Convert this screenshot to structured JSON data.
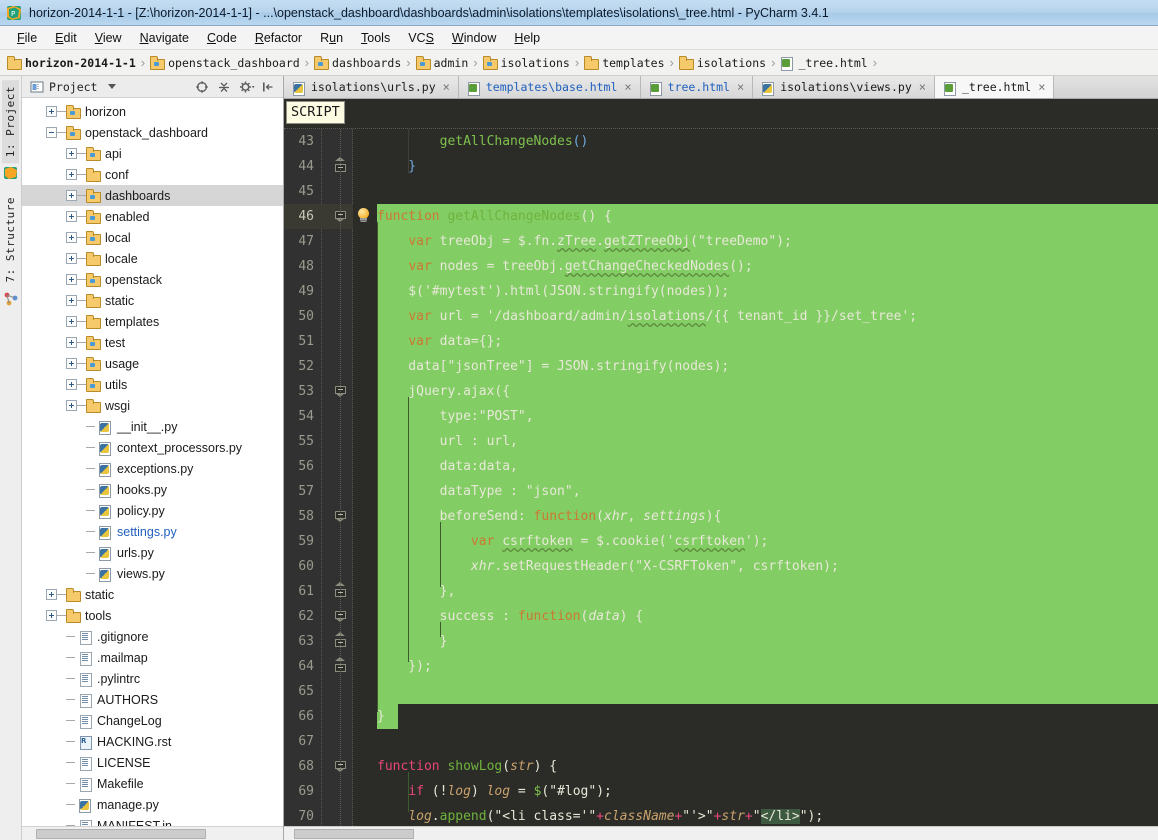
{
  "window": {
    "title": "horizon-2014-1-1 - [Z:\\horizon-2014-1-1] - ...\\openstack_dashboard\\dashboards\\admin\\isolations\\templates\\isolations\\_tree.html - PyCharm 3.4.1",
    "app_name": "PyCharm 3.4.1"
  },
  "menu": {
    "items": [
      {
        "label": "File",
        "mnemonic": "F"
      },
      {
        "label": "Edit",
        "mnemonic": "E"
      },
      {
        "label": "View",
        "mnemonic": "V"
      },
      {
        "label": "Navigate",
        "mnemonic": "N"
      },
      {
        "label": "Code",
        "mnemonic": "C"
      },
      {
        "label": "Refactor",
        "mnemonic": "R"
      },
      {
        "label": "Run",
        "mnemonic": "u"
      },
      {
        "label": "Tools",
        "mnemonic": "T"
      },
      {
        "label": "VCS",
        "mnemonic": "S"
      },
      {
        "label": "Window",
        "mnemonic": "W"
      },
      {
        "label": "Help",
        "mnemonic": "H"
      }
    ]
  },
  "breadcrumb": {
    "separator": "›",
    "items": [
      {
        "label": "horizon-2014-1-1",
        "icon": "folder-icon",
        "root": true
      },
      {
        "label": "openstack_dashboard",
        "icon": "package-folder-icon"
      },
      {
        "label": "dashboards",
        "icon": "package-folder-icon"
      },
      {
        "label": "admin",
        "icon": "package-folder-icon"
      },
      {
        "label": "isolations",
        "icon": "package-folder-icon"
      },
      {
        "label": "templates",
        "icon": "folder-icon"
      },
      {
        "label": "isolations",
        "icon": "folder-icon"
      },
      {
        "label": "_tree.html",
        "icon": "html-file-icon"
      }
    ]
  },
  "toolstrip": {
    "tabs": [
      {
        "label": "1: Project",
        "icon": "project-icon",
        "selected": true
      },
      {
        "label": "7: Structure",
        "icon": "structure-icon",
        "selected": false
      }
    ]
  },
  "project_panel": {
    "title": "Project",
    "title_icon": "project-view-icon",
    "dropdown_icon": "chevron-down-icon",
    "tools": [
      {
        "name": "scroll-from-source-icon",
        "glyph": "target"
      },
      {
        "name": "collapse-all-icon",
        "glyph": "collapse"
      },
      {
        "name": "settings-gear-icon",
        "glyph": "gear"
      },
      {
        "name": "hide-panel-icon",
        "glyph": "hide"
      }
    ],
    "tree": [
      {
        "label": "horizon",
        "depth": 1,
        "kind": "package",
        "state": "collapsed"
      },
      {
        "label": "openstack_dashboard",
        "depth": 1,
        "kind": "package",
        "state": "expanded"
      },
      {
        "label": "api",
        "depth": 2,
        "kind": "package",
        "state": "collapsed"
      },
      {
        "label": "conf",
        "depth": 2,
        "kind": "folder",
        "state": "collapsed"
      },
      {
        "label": "dashboards",
        "depth": 2,
        "kind": "package",
        "state": "collapsed",
        "selected": true
      },
      {
        "label": "enabled",
        "depth": 2,
        "kind": "package",
        "state": "collapsed"
      },
      {
        "label": "local",
        "depth": 2,
        "kind": "package",
        "state": "collapsed"
      },
      {
        "label": "locale",
        "depth": 2,
        "kind": "folder",
        "state": "collapsed"
      },
      {
        "label": "openstack",
        "depth": 2,
        "kind": "package",
        "state": "collapsed"
      },
      {
        "label": "static",
        "depth": 2,
        "kind": "folder",
        "state": "collapsed"
      },
      {
        "label": "templates",
        "depth": 2,
        "kind": "folder",
        "state": "collapsed"
      },
      {
        "label": "test",
        "depth": 2,
        "kind": "package",
        "state": "collapsed"
      },
      {
        "label": "usage",
        "depth": 2,
        "kind": "package",
        "state": "collapsed"
      },
      {
        "label": "utils",
        "depth": 2,
        "kind": "package",
        "state": "collapsed"
      },
      {
        "label": "wsgi",
        "depth": 2,
        "kind": "folder",
        "state": "collapsed"
      },
      {
        "label": "__init__.py",
        "depth": 3,
        "kind": "python",
        "state": "leaf"
      },
      {
        "label": "context_processors.py",
        "depth": 3,
        "kind": "python",
        "state": "leaf"
      },
      {
        "label": "exceptions.py",
        "depth": 3,
        "kind": "python",
        "state": "leaf"
      },
      {
        "label": "hooks.py",
        "depth": 3,
        "kind": "python",
        "state": "leaf"
      },
      {
        "label": "policy.py",
        "depth": 3,
        "kind": "python",
        "state": "leaf"
      },
      {
        "label": "settings.py",
        "depth": 3,
        "kind": "python",
        "state": "leaf",
        "vcs": true
      },
      {
        "label": "urls.py",
        "depth": 3,
        "kind": "python",
        "state": "leaf"
      },
      {
        "label": "views.py",
        "depth": 3,
        "kind": "python",
        "state": "leaf"
      },
      {
        "label": "static",
        "depth": 1,
        "kind": "folder",
        "state": "collapsed"
      },
      {
        "label": "tools",
        "depth": 1,
        "kind": "folder",
        "state": "collapsed"
      },
      {
        "label": ".gitignore",
        "depth": 2,
        "kind": "text",
        "state": "leaf"
      },
      {
        "label": ".mailmap",
        "depth": 2,
        "kind": "text",
        "state": "leaf"
      },
      {
        "label": ".pylintrc",
        "depth": 2,
        "kind": "text",
        "state": "leaf"
      },
      {
        "label": "AUTHORS",
        "depth": 2,
        "kind": "text",
        "state": "leaf"
      },
      {
        "label": "ChangeLog",
        "depth": 2,
        "kind": "text",
        "state": "leaf"
      },
      {
        "label": "HACKING.rst",
        "depth": 2,
        "kind": "rst",
        "state": "leaf"
      },
      {
        "label": "LICENSE",
        "depth": 2,
        "kind": "text",
        "state": "leaf"
      },
      {
        "label": "Makefile",
        "depth": 2,
        "kind": "text",
        "state": "leaf"
      },
      {
        "label": "manage.py",
        "depth": 2,
        "kind": "python",
        "state": "leaf"
      },
      {
        "label": "MANIFEST.in",
        "depth": 2,
        "kind": "text",
        "state": "leaf"
      }
    ]
  },
  "editor_tabs": {
    "close_glyph": "×",
    "items": [
      {
        "label": "isolations\\urls.py",
        "kind": "python",
        "active": false
      },
      {
        "label": "templates\\base.html",
        "kind": "html",
        "active": false
      },
      {
        "label": "tree.html",
        "kind": "html",
        "active": false
      },
      {
        "label": "isolations\\views.py",
        "kind": "python",
        "active": false
      },
      {
        "label": "_tree.html",
        "kind": "html",
        "active": true
      }
    ]
  },
  "editor": {
    "breadcrumb_tag": "SCRIPT",
    "current_line": 46,
    "first_line": 43,
    "last_line": 70,
    "highlight_color": "#82cd64",
    "background_color": "#2b2b27",
    "gutter_color": "#313131",
    "lines": [
      {
        "no": 43,
        "highlight": "none"
      },
      {
        "no": 44,
        "highlight": "none"
      },
      {
        "no": 45,
        "highlight": "none"
      },
      {
        "no": 46,
        "highlight": "full",
        "current": true,
        "bulb": true
      },
      {
        "no": 47,
        "highlight": "full"
      },
      {
        "no": 48,
        "highlight": "full"
      },
      {
        "no": 49,
        "highlight": "full"
      },
      {
        "no": 50,
        "highlight": "full"
      },
      {
        "no": 51,
        "highlight": "full"
      },
      {
        "no": 52,
        "highlight": "full"
      },
      {
        "no": 53,
        "highlight": "full"
      },
      {
        "no": 54,
        "highlight": "full"
      },
      {
        "no": 55,
        "highlight": "full"
      },
      {
        "no": 56,
        "highlight": "full"
      },
      {
        "no": 57,
        "highlight": "full"
      },
      {
        "no": 58,
        "highlight": "full"
      },
      {
        "no": 59,
        "highlight": "full"
      },
      {
        "no": 60,
        "highlight": "full"
      },
      {
        "no": 61,
        "highlight": "full"
      },
      {
        "no": 62,
        "highlight": "full"
      },
      {
        "no": 63,
        "highlight": "full"
      },
      {
        "no": 64,
        "highlight": "full"
      },
      {
        "no": 65,
        "highlight": "full"
      },
      {
        "no": 66,
        "highlight": "narrow"
      },
      {
        "no": 67,
        "highlight": "none"
      },
      {
        "no": 68,
        "highlight": "none"
      },
      {
        "no": 69,
        "highlight": "none"
      },
      {
        "no": 70,
        "highlight": "none"
      }
    ],
    "code_text": [
      "        getAllChangeNodes()",
      "    }",
      "",
      "function getAllChangeNodes() {",
      "    var treeObj = $.fn.zTree.getZTreeObj(\"treeDemo\");",
      "    var nodes = treeObj.getChangeCheckedNodes();",
      "    $('#mytest').html(JSON.stringify(nodes));",
      "    var url = '/dashboard/admin/isolations/{{ tenant_id }}/set_tree';",
      "    var data={};",
      "    data[\"jsonTree\"] = JSON.stringify(nodes);",
      "    jQuery.ajax({",
      "        type:\"POST\",",
      "        url : url,",
      "        data:data,",
      "        dataType : \"json\",",
      "        beforeSend: function(xhr, settings){",
      "            var csrftoken = $.cookie('csrftoken');",
      "            xhr.setRequestHeader(\"X-CSRFToken\", csrftoken);",
      "        },",
      "        success : function(data) {",
      "        }",
      "    });",
      "",
      "}",
      "",
      "function showLog(str) {",
      "    if (!log) log = $(\"#log\");",
      "    log.append(\"<li class='\"+className+\"'>\"+str+\"</li>\");"
    ]
  }
}
